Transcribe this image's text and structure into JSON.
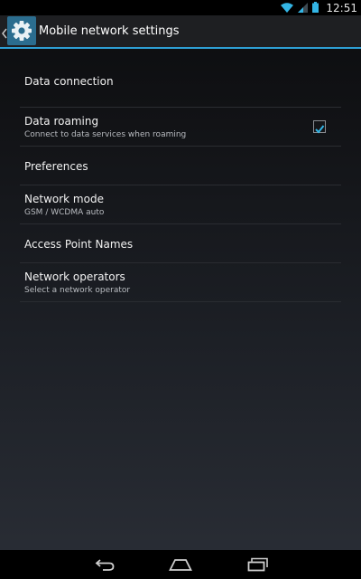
{
  "status_bar": {
    "time": "12:51",
    "icons": [
      "wifi-icon",
      "cellular-signal-icon",
      "battery-icon"
    ]
  },
  "action_bar": {
    "title": "Mobile network settings",
    "icon": "settings-gear-icon",
    "up_icon": "up-caret-icon"
  },
  "list": {
    "items": [
      {
        "title": "Data connection",
        "summary": ""
      },
      {
        "title": "Data roaming",
        "summary": "Connect to data services when roaming",
        "checked": true
      },
      {
        "title": "Preferences",
        "summary": ""
      },
      {
        "title": "Network mode",
        "summary": "GSM / WCDMA auto"
      },
      {
        "title": "Access Point Names",
        "summary": ""
      },
      {
        "title": "Network operators",
        "summary": "Select a network operator"
      }
    ]
  },
  "nav_bar": {
    "buttons": [
      "back-icon",
      "home-icon",
      "recent-apps-icon"
    ]
  },
  "colors": {
    "accent": "#2e9fd4",
    "status_icons": "#33b5e5"
  }
}
